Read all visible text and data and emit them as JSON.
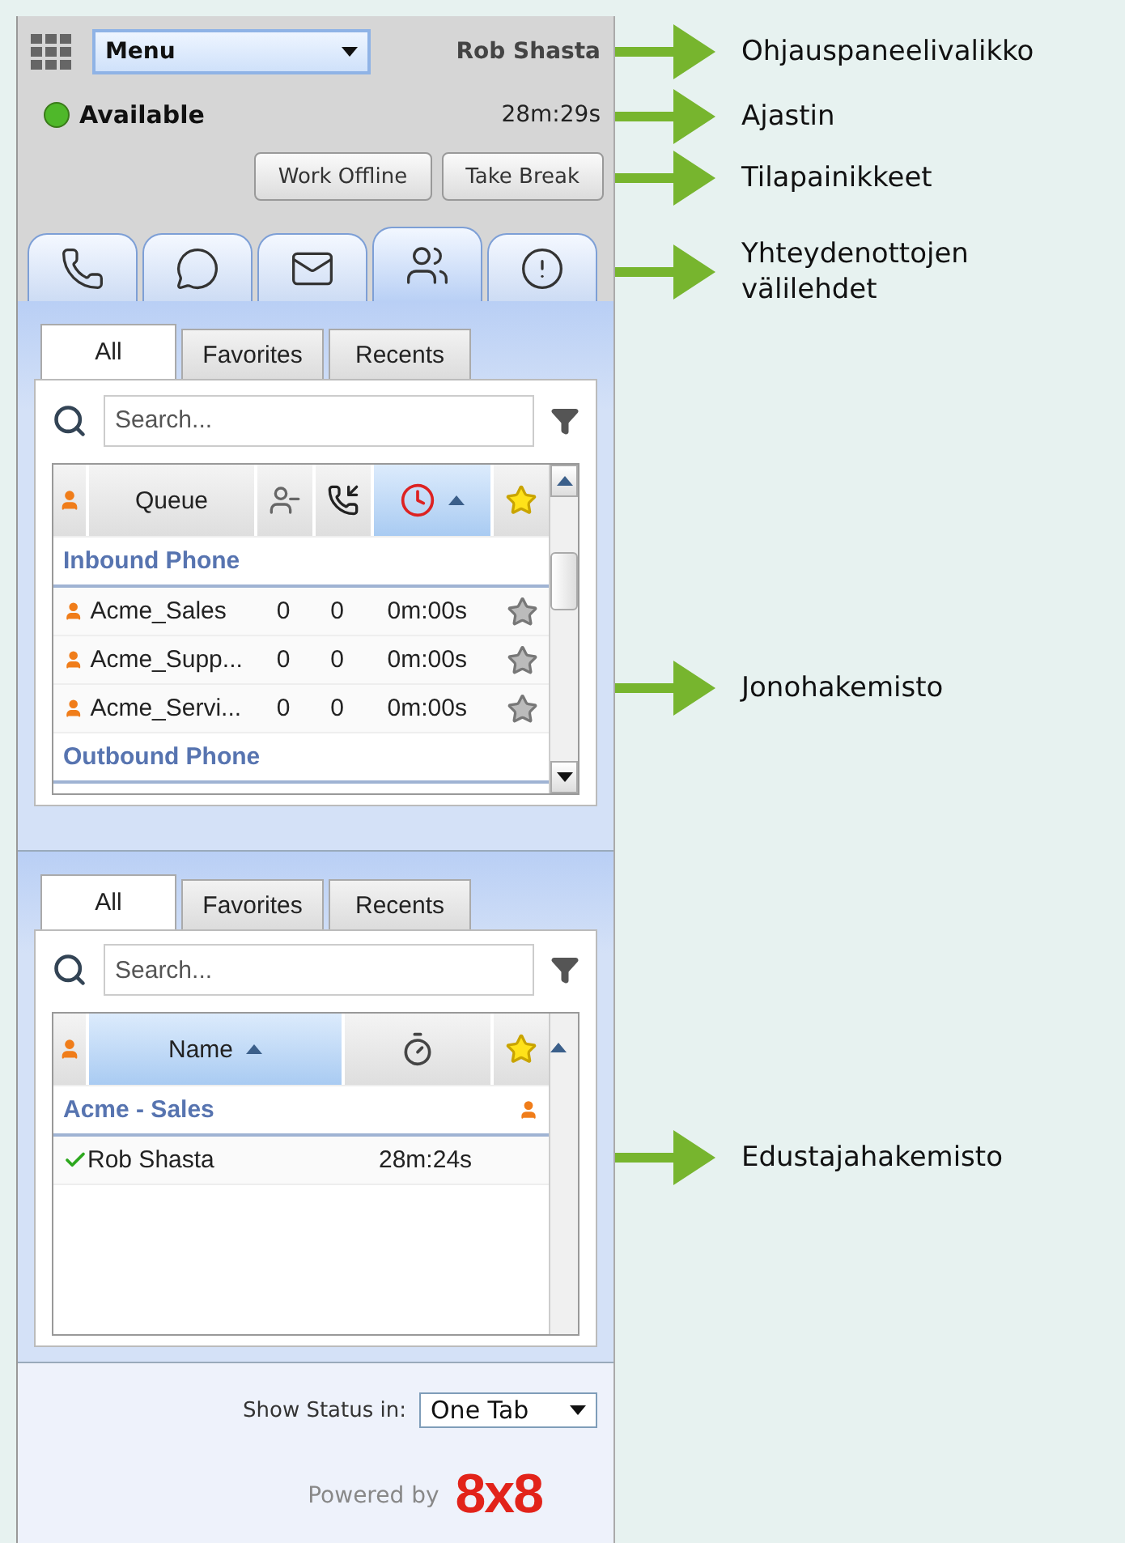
{
  "header": {
    "menu": "Menu",
    "user": "Rob Shasta"
  },
  "status": {
    "label": "Available",
    "color": "#4fb82a",
    "timer": "28m:29s"
  },
  "actions": [
    "Work Offline",
    "Take Break"
  ],
  "channel_tabs": [
    {
      "kind": "phone",
      "selected": false
    },
    {
      "kind": "chat",
      "selected": false
    },
    {
      "kind": "email",
      "selected": false
    },
    {
      "kind": "directory",
      "selected": true
    },
    {
      "kind": "alert",
      "selected": false
    }
  ],
  "queue_directory": {
    "subtabs": [
      {
        "label": "All",
        "selected": true
      },
      {
        "label": "Favorites",
        "selected": false
      },
      {
        "label": "Recents",
        "selected": false
      }
    ],
    "search": {
      "placeholder": "Search..."
    },
    "columns": [
      {
        "kind": "type",
        "sorted": false
      },
      {
        "kind": "name",
        "label": "Queue",
        "sorted": false
      },
      {
        "kind": "agents",
        "sorted": false
      },
      {
        "kind": "waiting",
        "sorted": false
      },
      {
        "kind": "wait-time",
        "sorted": true
      },
      {
        "kind": "favorite",
        "sorted": false
      }
    ],
    "groups": [
      {
        "name": "Inbound Phone",
        "rows": [
          {
            "name": "Acme_Sales",
            "col_3": "0",
            "col_4": "0",
            "time": "0m:00s"
          },
          {
            "name": "Acme_Supp...",
            "col_3": "0",
            "col_4": "0",
            "time": "0m:00s"
          },
          {
            "name": "Acme_Servi...",
            "col_3": "0",
            "col_4": "0",
            "time": "0m:00s"
          }
        ]
      },
      {
        "name": "Outbound Phone"
      }
    ]
  },
  "agent_directory": {
    "subtabs": [
      {
        "label": "All",
        "selected": true
      },
      {
        "label": "Favorites",
        "selected": false
      },
      {
        "label": "Recents",
        "selected": false
      }
    ],
    "search": {
      "placeholder": "Search..."
    },
    "columns": [
      {
        "kind": "type",
        "sorted": false
      },
      {
        "kind": "name",
        "label": "Name",
        "sorted": true
      },
      {
        "kind": "duration",
        "sorted": false
      },
      {
        "kind": "favorite",
        "sorted": false
      }
    ],
    "groups": [
      {
        "name": "Acme - Sales",
        "rows": [
          {
            "name": "Rob Shasta",
            "time": "28m:24s",
            "available": true
          }
        ]
      }
    ]
  },
  "footer": {
    "show_status": {
      "label": "Show Status in:",
      "value": "One Tab"
    },
    "powered_by": "Powered by",
    "logo": "8x8"
  },
  "annotations": [
    "Ohjauspaneelivalikko",
    "Ajastin",
    "Tilapainikkeet",
    "Yhteydenottojen välilehdet",
    "Jonohakemisto",
    "Edustajahakemisto"
  ]
}
